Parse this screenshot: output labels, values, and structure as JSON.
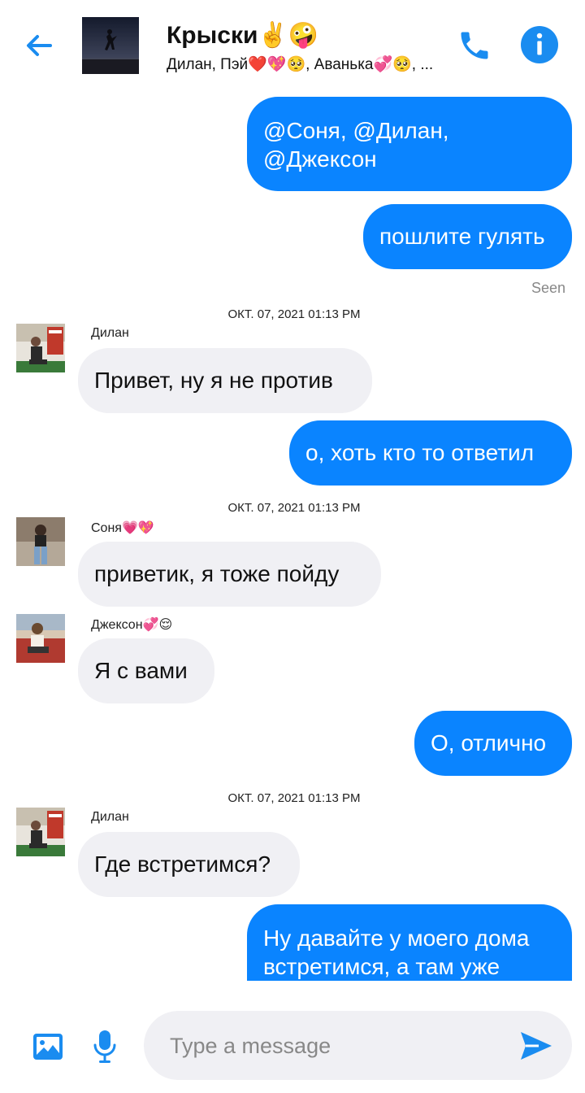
{
  "header": {
    "title": "Крыски✌️🤪",
    "members": "Дилан, Пэй❤️💖🥺, Аванька💞🥺, ..."
  },
  "messages": [
    {
      "type": "out",
      "text": "@Соня, @Дилан, @Джексон"
    },
    {
      "type": "out",
      "text": "пошлите гулять"
    },
    {
      "type": "seen",
      "text": "Seen"
    },
    {
      "type": "timestamp",
      "text": "ОКТ. 07, 2021 01:13 PM"
    },
    {
      "type": "in",
      "sender": "Дилан",
      "text": "Привет, ну я не против"
    },
    {
      "type": "out",
      "text": "о, хоть кто то ответил"
    },
    {
      "type": "timestamp",
      "text": "ОКТ. 07, 2021 01:13 PM"
    },
    {
      "type": "in",
      "sender": "Соня💗💖",
      "text": "приветик, я тоже пойду"
    },
    {
      "type": "in",
      "sender": "Джексон💞😌",
      "text": "Я с вами"
    },
    {
      "type": "out",
      "text": "О, отлично"
    },
    {
      "type": "timestamp",
      "text": "ОКТ. 07, 2021 01:13 PM"
    },
    {
      "type": "in",
      "sender": "Дилан",
      "text": "Где встретимся?"
    },
    {
      "type": "out",
      "text": "Ну давайте у моего дома встретимся, а там уже"
    }
  ],
  "composer": {
    "placeholder": "Type a message"
  },
  "colors": {
    "accent": "#0a84ff",
    "incoming_bubble": "#f0f0f4",
    "icon_blue": "#1a8cf0"
  },
  "icons": [
    "back-arrow-icon",
    "phone-icon",
    "info-icon",
    "image-icon",
    "microphone-icon",
    "send-icon"
  ]
}
